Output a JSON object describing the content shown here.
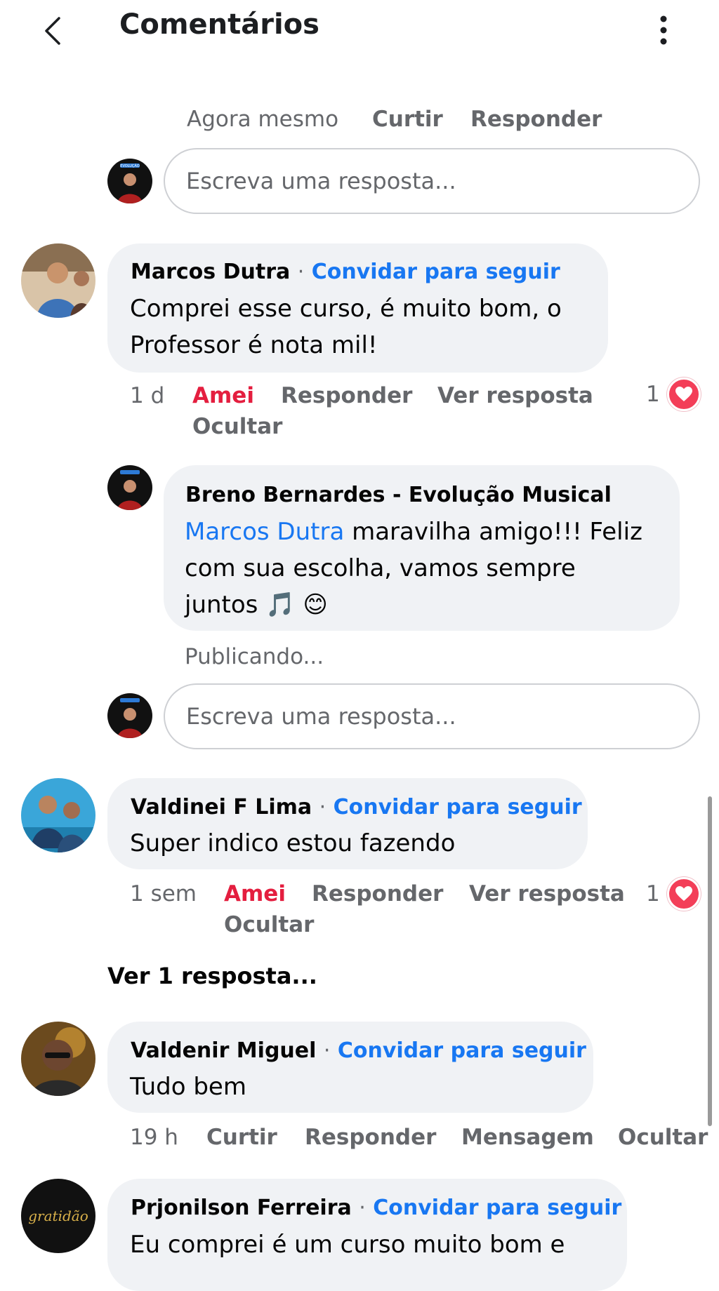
{
  "header": {
    "title": "Comentários"
  },
  "top_meta": {
    "time": "Agora mesmo",
    "like": "Curtir",
    "reply": "Responder"
  },
  "reply_placeholder": "Escreva uma resposta...",
  "follow_label": "Convidar para seguir",
  "separator": "·",
  "comments": [
    {
      "author": "Marcos Dutra",
      "line1": "Comprei esse curso, é muito bom, o",
      "line2": "Professor é nota mil!",
      "time": "1 d",
      "reaction_label": "Amei",
      "reply": "Responder",
      "view_reply": "Ver resposta",
      "hide": "Ocultar",
      "reaction_count": "1"
    },
    {
      "author": "Valdinei F Lima",
      "line1": "Super indico estou fazendo",
      "time": "1 sem",
      "reaction_label": "Amei",
      "reply": "Responder",
      "view_reply": "Ver resposta",
      "hide": "Ocultar",
      "reaction_count": "1"
    },
    {
      "author": "Valdenir Miguel",
      "line1": "Tudo bem",
      "time": "19 h",
      "like": "Curtir",
      "reply": "Responder",
      "message": "Mensagem",
      "hide": "Ocultar"
    },
    {
      "author": "Prjonilson Ferreira",
      "line1": "Eu comprei é um curso muito bom e"
    }
  ],
  "nested_reply": {
    "author": "Breno Bernardes - Evolução Musical",
    "mention": "Marcos Dutra",
    "line1_rest": " maravilha amigo!!! Feliz",
    "line2": "com sua escolha, vamos sempre",
    "line3": "juntos 🎵 😊",
    "status": "Publicando..."
  },
  "see_replies": "Ver 1 resposta...",
  "avatar_logo_text": "EVOLUÇÃO",
  "avatar_script_text": "gratidão",
  "colors": {
    "link": "#1877f2",
    "love": "#e41e3f",
    "bubble": "#f0f2f5",
    "muted": "#65676b"
  },
  "icons": [
    "back-chevron-icon",
    "more-vertical-icon",
    "heart-icon"
  ]
}
